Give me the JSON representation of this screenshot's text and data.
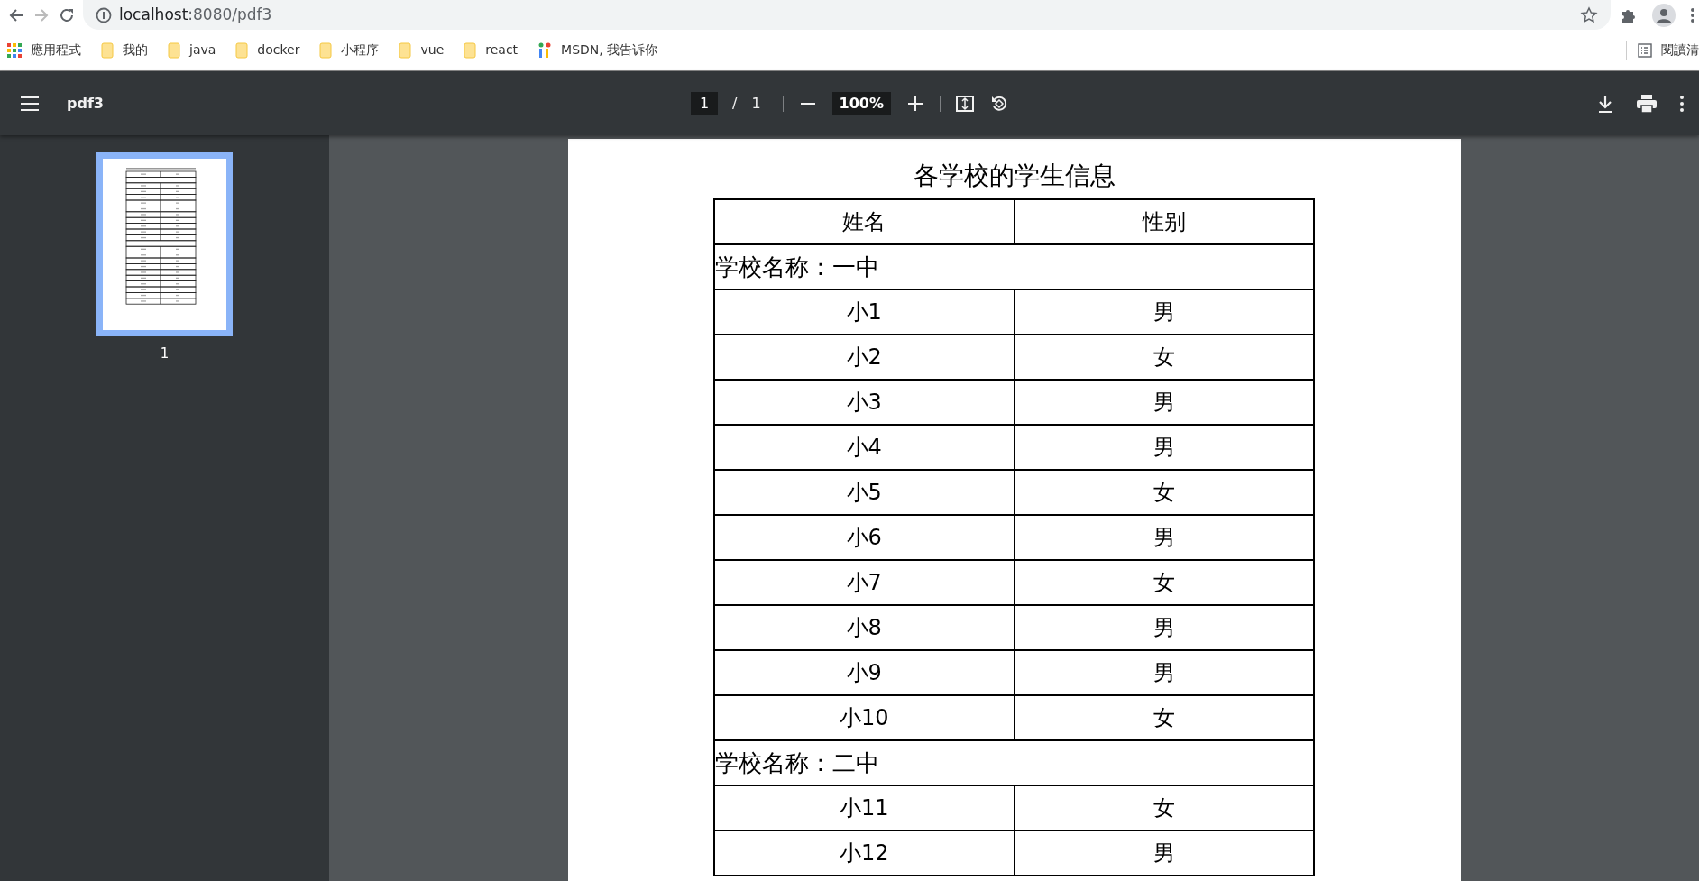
{
  "browser": {
    "url_host": "localhost",
    "url_rest": ":8080/pdf3",
    "bookmarks": [
      {
        "kind": "apps",
        "label": "應用程式"
      },
      {
        "kind": "folder",
        "label": "我的"
      },
      {
        "kind": "folder",
        "label": "java"
      },
      {
        "kind": "folder",
        "label": "docker"
      },
      {
        "kind": "folder",
        "label": "小程序"
      },
      {
        "kind": "folder",
        "label": "vue"
      },
      {
        "kind": "folder",
        "label": "react"
      },
      {
        "kind": "site",
        "label": "MSDN, 我告诉你"
      }
    ],
    "reading_list": "閱讀清"
  },
  "viewer": {
    "title": "pdf3",
    "page": "1",
    "page_separator": "/",
    "page_total": "1",
    "zoom": "100%"
  },
  "thumbnails": [
    {
      "label": "1",
      "selected": true
    }
  ],
  "document": {
    "title": "各学校的学生信息",
    "columns": [
      "姓名",
      "性别"
    ],
    "rows": [
      {
        "kind": "group",
        "text": "学校名称：一中"
      },
      {
        "kind": "student",
        "cells": [
          "小1",
          "男"
        ]
      },
      {
        "kind": "student",
        "cells": [
          "小2",
          "女"
        ]
      },
      {
        "kind": "student",
        "cells": [
          "小3",
          "男"
        ]
      },
      {
        "kind": "student",
        "cells": [
          "小4",
          "男"
        ]
      },
      {
        "kind": "student",
        "cells": [
          "小5",
          "女"
        ]
      },
      {
        "kind": "student",
        "cells": [
          "小6",
          "男"
        ]
      },
      {
        "kind": "student",
        "cells": [
          "小7",
          "女"
        ]
      },
      {
        "kind": "student",
        "cells": [
          "小8",
          "男"
        ]
      },
      {
        "kind": "student",
        "cells": [
          "小9",
          "男"
        ]
      },
      {
        "kind": "student",
        "cells": [
          "小10",
          "女"
        ]
      },
      {
        "kind": "group",
        "text": "学校名称：二中"
      },
      {
        "kind": "student",
        "cells": [
          "小11",
          "女"
        ]
      },
      {
        "kind": "student",
        "cells": [
          "小12",
          "男"
        ]
      }
    ]
  }
}
